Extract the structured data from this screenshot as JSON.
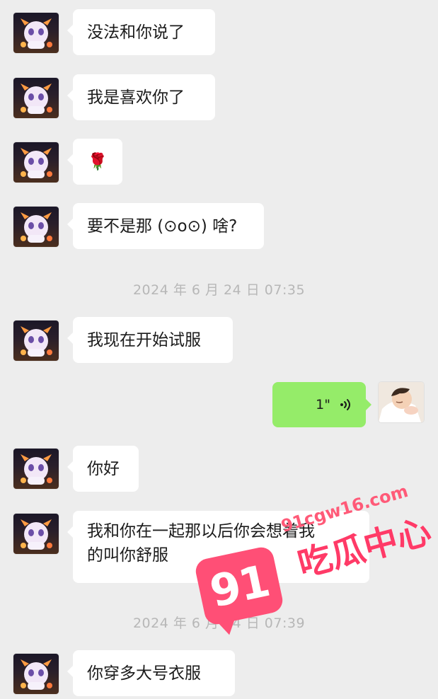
{
  "messages": {
    "m1": "没法和你说了",
    "m2": "我是喜欢你了",
    "m3": "🌹",
    "m4": "要不是那 (⊙o⊙) 啥?",
    "m5": "我现在开始试服",
    "m6": "你好",
    "m7": "我和你在一起那以后你会想着我\n的叫你舒服",
    "m8": "你穿多大号衣服"
  },
  "timestamps": {
    "t1": "2024 年 6 月 24 日 07:35",
    "t2": "2024 年 6 月 24 日 07:39"
  },
  "voice_message": {
    "duration": "1\"",
    "icon": "voice-wave-icon"
  },
  "avatars": {
    "contact": "dragon-avatar",
    "self": "baby-avatar"
  },
  "watermark": {
    "badge": "91",
    "label": "吃瓜中心",
    "domain": "91cgw16.com"
  },
  "colors": {
    "background": "#ededed",
    "incoming_bubble": "#ffffff",
    "outgoing_bubble": "#95ec69",
    "timestamp": "#b7b7b7",
    "watermark": "#ff4f76"
  }
}
